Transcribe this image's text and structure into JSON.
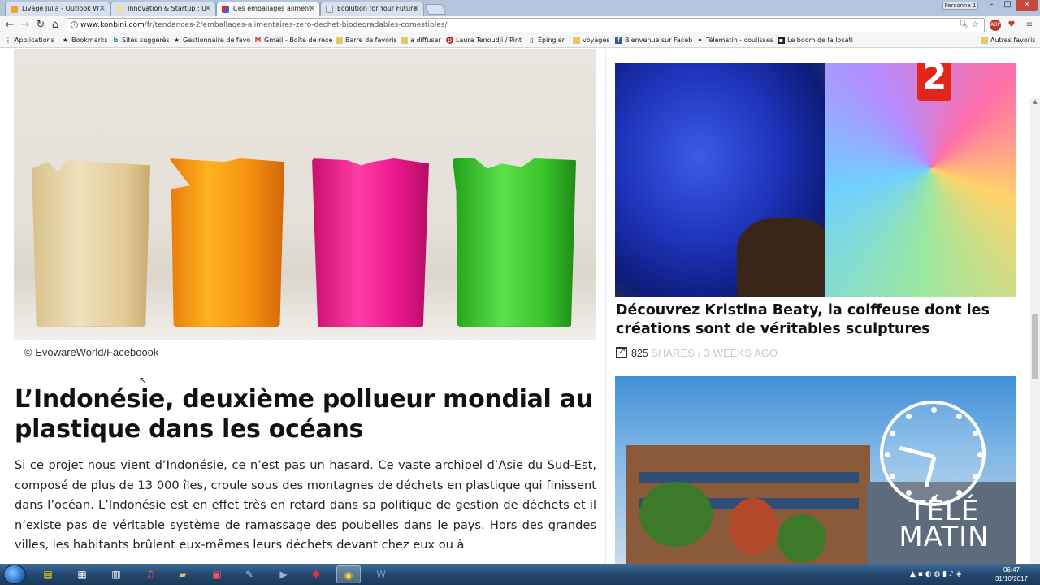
{
  "browser": {
    "tabs": [
      {
        "title": "Livage Julia - Outlook W",
        "active": false,
        "color": "#f0a030"
      },
      {
        "title": "Innovation & Startup : U",
        "active": false,
        "color": "#c8c8c8"
      },
      {
        "title": "Ces emballages aliment",
        "active": true,
        "color": "#e22c2c"
      },
      {
        "title": "Ecolution for Your Future",
        "active": false,
        "color": "#dfe6f0"
      }
    ],
    "user_button": "Personne 1",
    "url_host": "www.konbini.com",
    "url_path": "/fr/tendances-2/emballages-alimentaires-zero-dechet-biodegradables-comestibles/",
    "bookmarks": [
      {
        "label": "Applications",
        "icon": "apps-grid-icon"
      },
      {
        "label": "Bookmarks",
        "icon": "star-icon"
      },
      {
        "label": "Sites suggérés",
        "icon": "bing-icon"
      },
      {
        "label": "Gestionnaire de favo",
        "icon": "star-icon"
      },
      {
        "label": "Gmail - Boîte de réce",
        "icon": "gmail-icon"
      },
      {
        "label": "Barre de favoris",
        "icon": "folder-icon"
      },
      {
        "label": "a diffuser",
        "icon": "folder-icon"
      },
      {
        "label": "Laura Tenoudji / Pint",
        "icon": "pinterest-icon"
      },
      {
        "label": "Épingler",
        "icon": "page-icon"
      },
      {
        "label": "voyages",
        "icon": "folder-icon"
      },
      {
        "label": "Bienvenue sur Faceb",
        "icon": "facebook-icon"
      },
      {
        "label": "Télématin - coulisses",
        "icon": "telematin-icon"
      },
      {
        "label": "Le boom de la locati",
        "icon": "page-icon"
      },
      {
        "label": "Autres favoris",
        "icon": "folder-icon"
      }
    ]
  },
  "article": {
    "image_caption": "© EvowareWorld/Faceboook",
    "heading": "L’Indonésie, deuxième pollueur mondial au plastique dans les océans",
    "body": "Si ce projet nous vient d’Indonésie, ce n’est pas un hasard. Ce vaste archipel d’Asie du Sud-Est, composé de plus de 13 000 îles, croule sous des montagnes de déchets en plastique qui finissent dans l’océan. L’Indonésie est en effet très en retard dans sa politique de gestion de déchets et il n’existe pas de véritable système de ramassage des poubelles dans le pays. Hors des grandes villes, les habitants brûlent eux-mêmes leurs déchets devant chez eux ou à",
    "cup_colors": [
      "#e6d3a8",
      "#f28a14",
      "#e8158a",
      "#38c22a"
    ]
  },
  "sidebar": {
    "card1": {
      "title": "Découvrez Kristina Beaty, la coiffeuse dont les créations sont de véritables sculptures",
      "shares_count": "825",
      "shares_label": "SHARES / 3 WEEKS AGO",
      "channel_logo": "2"
    },
    "card2": {
      "overlay_line1": "TÉLÉ",
      "overlay_line2": "MATIN"
    }
  },
  "taskbar": {
    "time": "06:47",
    "date": "31/10/2017"
  }
}
